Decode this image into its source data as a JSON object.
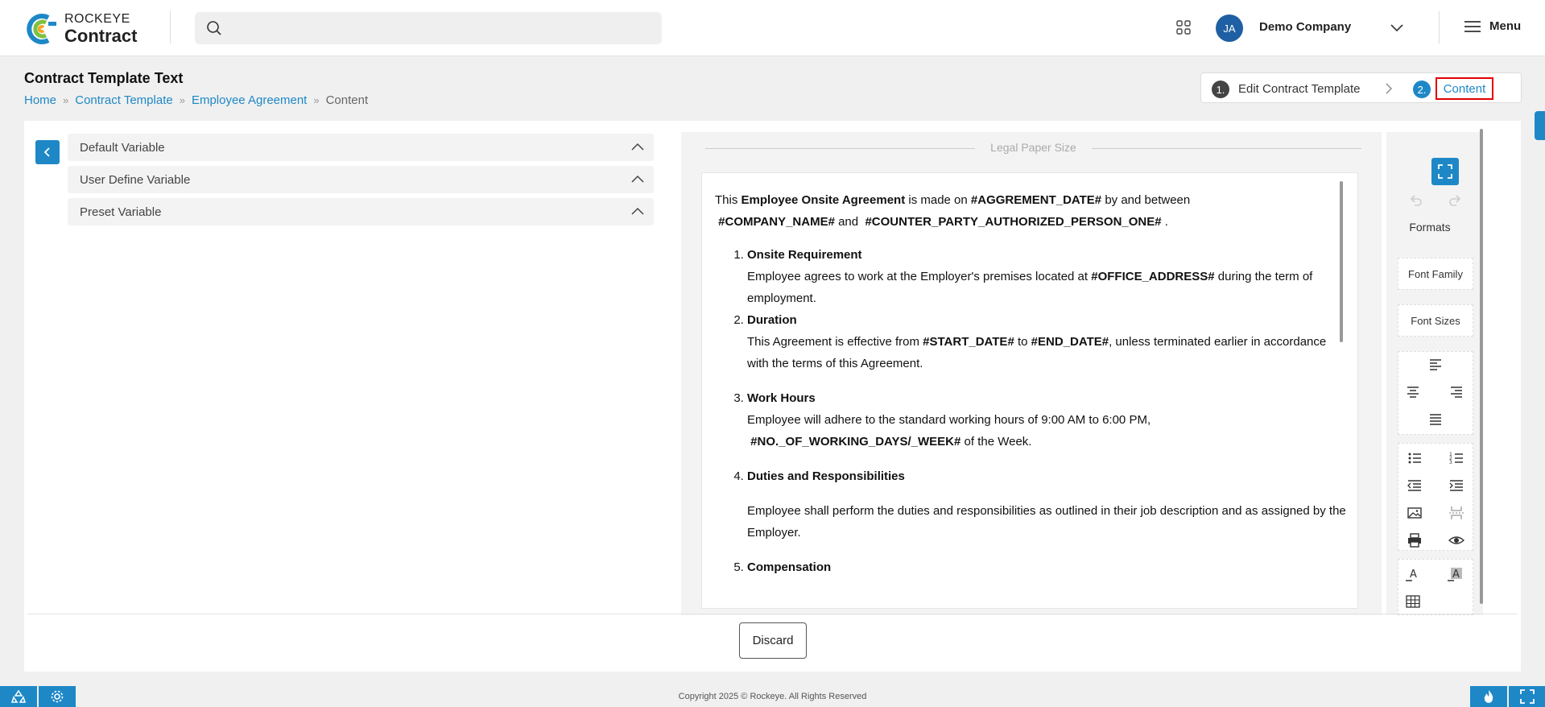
{
  "brand": {
    "top": "ROCKEYE",
    "bottom": "Contract",
    "colors": {
      "blue": "#1e88c7",
      "green": "#7bc143",
      "orange": "#f5a623"
    }
  },
  "header": {
    "search_placeholder": "",
    "avatar_initials": "JA",
    "company": "Demo Company",
    "menu_label": "Menu"
  },
  "page": {
    "title": "Contract Template Text",
    "breadcrumb": [
      "Home",
      "Contract Template",
      "Employee Agreement",
      "Content"
    ]
  },
  "stepper": {
    "step1_num": "1.",
    "step1_label": "Edit Contract Template",
    "step2_num": "2.",
    "step2_label": "Content"
  },
  "accordion": {
    "items": [
      {
        "label": "Default Variable"
      },
      {
        "label": "User Define Variable"
      },
      {
        "label": "Preset Variable"
      }
    ]
  },
  "editor": {
    "paper_label": "Legal Paper Size",
    "intro": {
      "t1": "This ",
      "b1": "Employee Onsite Agreement",
      "t2": " is made on ",
      "b2": "#AGGREMENT_DATE#",
      "t3": "  by and between",
      "b3": "#COMPANY_NAME#",
      "t4": " and ",
      "b4": "#COUNTER_PARTY_AUTHORIZED_PERSON_ONE#",
      "t5": " ."
    },
    "clauses": [
      {
        "heading": "Onsite Requirement",
        "t1": "Employee agrees to work at the Employer's premises located at  ",
        "b1": "#OFFICE_ADDRESS#",
        "t2": " during the term of employment."
      },
      {
        "heading": "Duration",
        "t1": "This Agreement is effective from  ",
        "b1": "#START_DATE#",
        "t2": " to  ",
        "b2": "#END_DATE#",
        "t3": ", unless terminated earlier in accordance with the terms of this Agreement."
      },
      {
        "heading": "Work Hours",
        "t1": "Employee will adhere to the standard working hours of 9:00 AM to 6:00 PM,",
        "b1": "#NO._OF_WORKING_DAYS/_WEEK#",
        "t2": " of the Week."
      },
      {
        "heading": "Duties and Responsibilities",
        "t1": "Employee shall perform the duties and responsibilities as outlined in their job description and as assigned by the Employer."
      },
      {
        "heading": "Compensation"
      }
    ]
  },
  "toolbar": {
    "formats": "Formats",
    "font_family": "Font Family",
    "font_sizes": "Font Sizes",
    "icons": [
      "fullscreen-icon",
      "undo-icon",
      "redo-icon",
      "align-left-icon",
      "align-center-icon",
      "align-right-icon",
      "align-justify-icon",
      "bullet-list-icon",
      "numbered-list-icon",
      "outdent-icon",
      "indent-icon",
      "image-icon",
      "page-break-icon",
      "print-icon",
      "preview-icon",
      "text-color-icon",
      "highlight-color-icon",
      "table-icon"
    ]
  },
  "actions": {
    "discard": "Discard"
  },
  "footer": {
    "copyright": "Copyright 2025 © Rockeye. All Rights Reserved"
  }
}
